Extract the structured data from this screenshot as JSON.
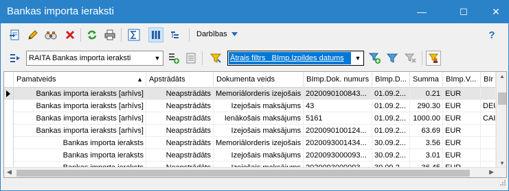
{
  "window": {
    "title": "Bankas importa ieraksti",
    "minimize": "—",
    "maximize": "☐",
    "close": "✕"
  },
  "toolbar": {
    "actions_menu": "Darbības",
    "help": "?"
  },
  "filterbar": {
    "view_value": "RAITA Bankas importa ieraksti",
    "quick_filter_value": "Ātrais filtrs_ BImp.Izpildes datums"
  },
  "grid": {
    "columns": [
      "Pamatveids",
      "Apstrādāts",
      "Dokumenta veids",
      "BImp.Dok. numurs",
      "BImp.D...",
      "Summa",
      "BImp.V...",
      "BIr"
    ],
    "rows": [
      [
        "Bankas importa ieraksts [arhīvs]",
        "Neapstrādāts",
        "Memoriālorderis izejošais",
        "2020090100843...",
        "01.09.2...",
        "0.21",
        "EUR",
        ""
      ],
      [
        "Bankas importa ieraksts [arhīvs]",
        "Neapstrādāts",
        "Izejošais maksājums",
        "43",
        "01.09.2...",
        "290.30",
        "EUR",
        "DEU"
      ],
      [
        "Bankas importa ieraksts [arhīvs]",
        "Neapstrādāts",
        "Ienākošais maksājums",
        "5161",
        "01.09.2...",
        "1000.00",
        "EUR",
        "CAI"
      ],
      [
        "Bankas importa ieraksts [arhīvs]",
        "Neapstrādāts",
        "Izejošais maksājums",
        "2020090100124...",
        "01.09.2...",
        "63.69",
        "EUR",
        ""
      ],
      [
        "Bankas importa ieraksts",
        "Neapstrādāts",
        "Memoriālorderis izejošais",
        "2020093001434...",
        "30.09.2...",
        "3.56",
        "EUR",
        ""
      ],
      [
        "Bankas importa ieraksts",
        "Neapstrādāts",
        "Izejošais maksājums",
        "2020093000093...",
        "30.09.2...",
        "3.01",
        "EUR",
        ""
      ],
      [
        "Bankas importa ieraksts",
        "Neapstrādāts",
        "Izejošais maksājums",
        "2020093000093...",
        "30.09.2...",
        "36.45",
        "EUR",
        ""
      ]
    ]
  },
  "colors": {
    "titlebar": "#2a82c9",
    "selection": "#0078d7"
  },
  "icons": [
    "new-record-icon",
    "edit-icon",
    "view-icon",
    "delete-icon",
    "refresh-icon",
    "print-icon",
    "sum-icon",
    "columns-icon",
    "tree-icon",
    "chevron-down-icon",
    "help-icon",
    "view-select-icon",
    "add-view-icon",
    "view-list-icon",
    "filter-icon",
    "add-filter-icon",
    "filter-settings-icon",
    "clear-filter-icon",
    "person-filter-icon",
    "sort-asc-icon",
    "current-row-icon",
    "resize-grip-icon"
  ]
}
